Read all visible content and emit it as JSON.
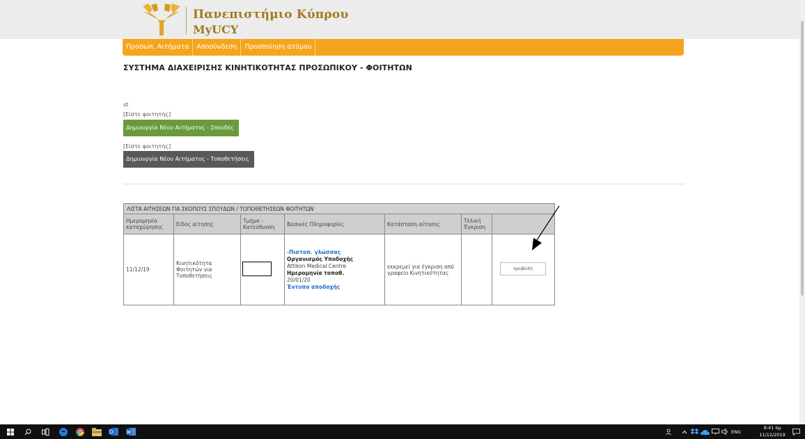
{
  "header": {
    "university_name": "Πανεπιστήμιο Κύπρου",
    "app_name": "MyUCY",
    "colors": {
      "brand_gold": "#a07a1c",
      "nav_orange": "#f5a51d"
    }
  },
  "nav": {
    "items": [
      {
        "label": "Προσωπ. Αιτήματα"
      },
      {
        "label": "Αποσύνδεση"
      },
      {
        "label": "Προσποίηση ατόμου"
      }
    ]
  },
  "page": {
    "title": "ΣΥΣΤΗΜΑ ΔΙΑΧΕΙΡΙΣΗΣ ΚΙΝΗΤΙΚΟΤΗΤΑΣ ΠΡΟΣΩΠΙΚΟΥ - ΦΟΙΤΗΤΩΝ",
    "user": "st",
    "role_label_1": "[Είστε φοιτητής]",
    "button_studies": "Δημιουργία Νέου Αιτήματος - Σπουδές",
    "role_label_2": "[Είστε φοιτητής]",
    "button_placements": "Δημιουργία Νέου Αιτήματος - Τοποθετήσεις"
  },
  "table": {
    "caption": "ΛΙΣΤΑ ΑΙΤΗΣΕΩΝ ΓΙΑ ΣΚΟΠΟΥΣ ΣΠΟΥΔΩΝ / ΤΟΠΟΘΕΤΗΣΕΩΝ ΦΟΙΤΗΤΩΝ",
    "headers": [
      "Ημερομηνία καταχώρησης",
      "Είδος αίτησης",
      "Τμήμα - Κατεύθυνση",
      "Βασικές Πληροφορίες",
      "Κατάσταση αίτησης",
      "Τελική Έγκριση",
      ""
    ],
    "rows": [
      {
        "date": "11/12/19",
        "type": "Κινητικότητα Φοιτητών για Τοποθετήσεις",
        "department": "",
        "info": {
          "lang_link": "-Πιστοπ. γλώσσας",
          "org_label": "Οργανισμός Υποδοχής",
          "org_value": "Attikon Medical Centre",
          "date_label": "Ημερομηνία τοποθ.",
          "date_value": "20/01/20",
          "form_link": "Έντυπο αποδοχής"
        },
        "status": "εκκρεμεί για έγκριση από γραφείο Κινητικότητας",
        "final_approval": "",
        "action": "προβολή"
      }
    ]
  },
  "taskbar": {
    "time": "9:41 πμ",
    "date": "11/12/2019",
    "language": "ENG"
  }
}
